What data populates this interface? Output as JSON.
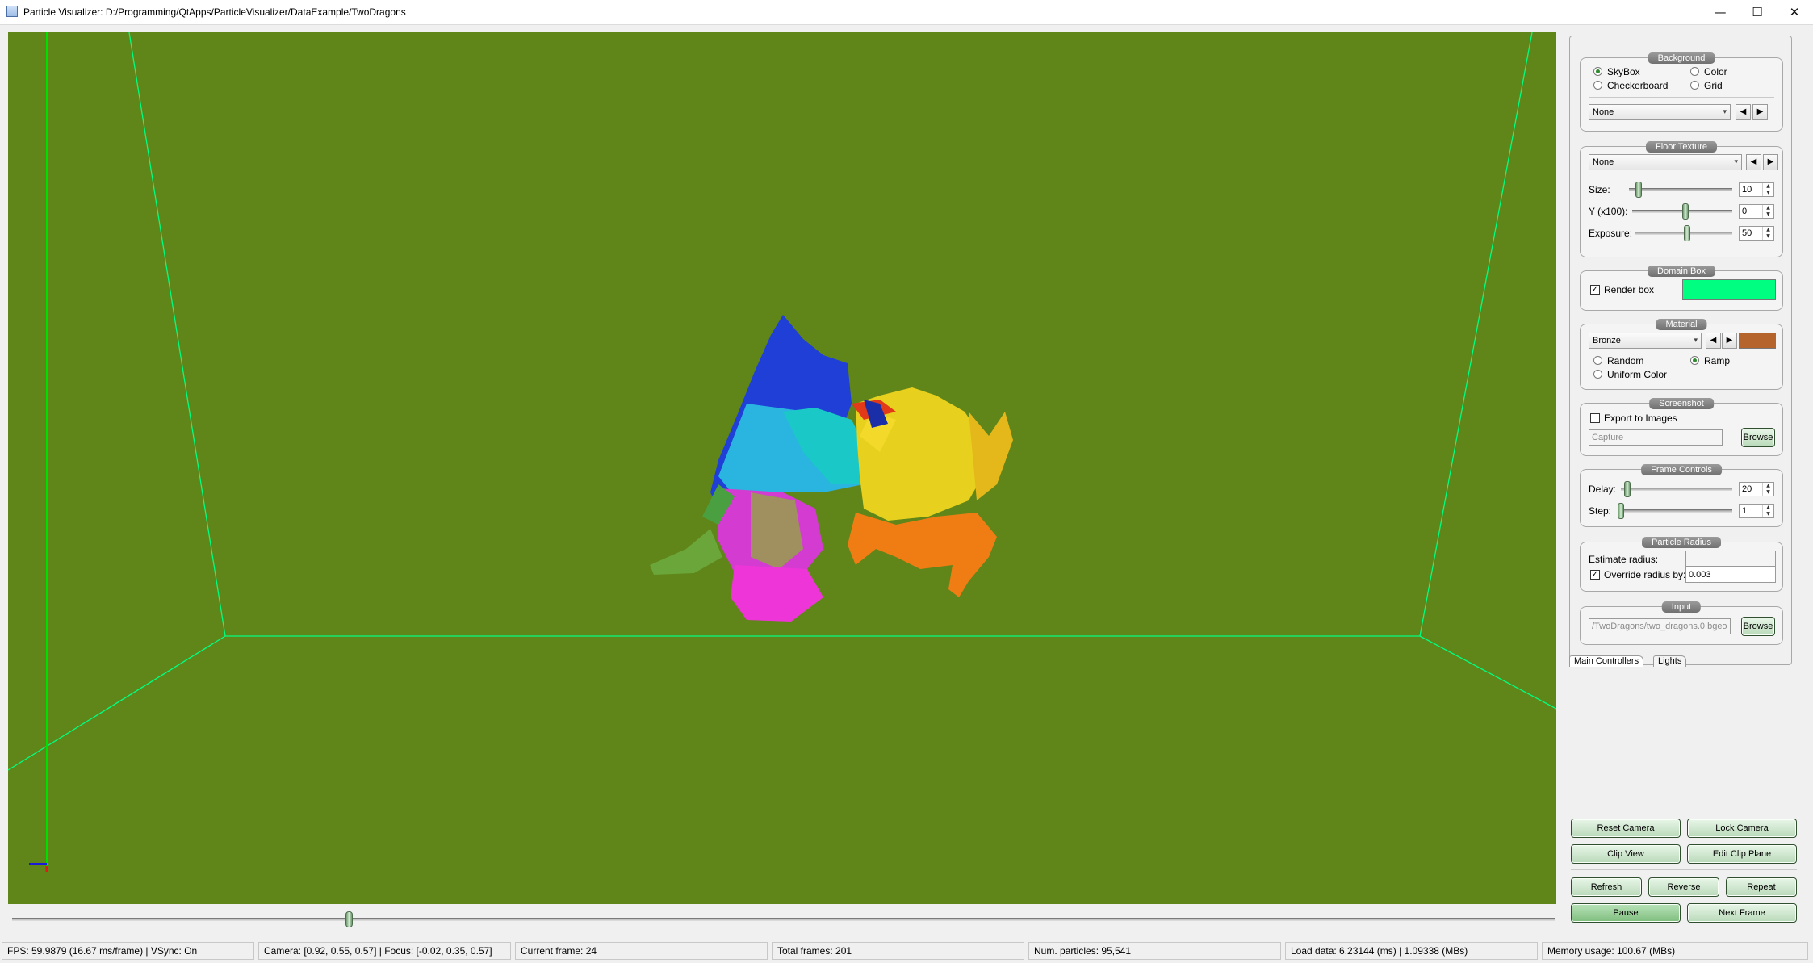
{
  "window": {
    "title": "Particle Visualizer: D:/Programming/QtApps/ParticleVisualizer/DataExample/TwoDragons",
    "minimize_glyph": "—",
    "maximize_glyph": "☐",
    "close_glyph": "✕"
  },
  "colors": {
    "viewport_bg": "#608519",
    "domain_box": "#00ff80",
    "material_swatch": "#b5652c",
    "accent_green": "#2e8b2e"
  },
  "timeline": {
    "current_frame": 24,
    "total_frames": 201
  },
  "panel": {
    "background": {
      "title": "Background",
      "options": [
        "SkyBox",
        "Color",
        "Checkerboard",
        "Grid"
      ],
      "selected": "SkyBox",
      "combo_value": "None",
      "prev_glyph": "◀",
      "next_glyph": "▶"
    },
    "floor_texture": {
      "title": "Floor Texture",
      "combo_value": "None",
      "size_label": "Size:",
      "size_value": "10",
      "y_label": "Y (x100):",
      "y_value": "0",
      "exposure_label": "Exposure:",
      "exposure_value": "50"
    },
    "domain_box": {
      "title": "Domain Box",
      "render_box_label": "Render box",
      "render_box_checked": true
    },
    "material": {
      "title": "Material",
      "combo_value": "Bronze",
      "options": [
        "Random",
        "Ramp",
        "Uniform Color"
      ],
      "selected": "Ramp"
    },
    "screenshot": {
      "title": "Screenshot",
      "export_label": "Export to Images",
      "capture_placeholder": "Capture",
      "browse_label": "Browse"
    },
    "frame_controls": {
      "title": "Frame Controls",
      "delay_label": "Delay:",
      "delay_value": "20",
      "step_label": "Step:",
      "step_value": "1"
    },
    "particle_radius": {
      "title": "Particle Radius",
      "estimate_label": "Estimate radius:",
      "estimate_value": "",
      "override_label": "Override radius by:",
      "override_value": "0.003"
    },
    "input": {
      "title": "Input",
      "path_value": "/TwoDragons/two_dragons.0.bgeo",
      "browse_label": "Browse"
    },
    "tabs": [
      "Main Controllers",
      "Lights"
    ]
  },
  "buttons": {
    "reset_camera": "Reset Camera",
    "lock_camera": "Lock Camera",
    "clip_view": "Clip View",
    "edit_clip_plane": "Edit Clip Plane",
    "refresh": "Refresh",
    "reverse": "Reverse",
    "repeat": "Repeat",
    "pause": "Pause",
    "next_frame": "Next Frame"
  },
  "status": {
    "fps": "FPS: 59.9879 (16.67 ms/frame) | VSync: On",
    "camera": "Camera: [0.92, 0.55, 0.57] | Focus: [-0.02, 0.35, 0.57]",
    "current_frame": "Current frame: 24",
    "total_frames": "Total frames: 201",
    "num_particles": "Num. particles: 95,541",
    "load_data": "Load data: 6.23144 (ms) | 1.09338 (MBs)",
    "memory": "Memory usage: 100.67 (MBs)"
  }
}
